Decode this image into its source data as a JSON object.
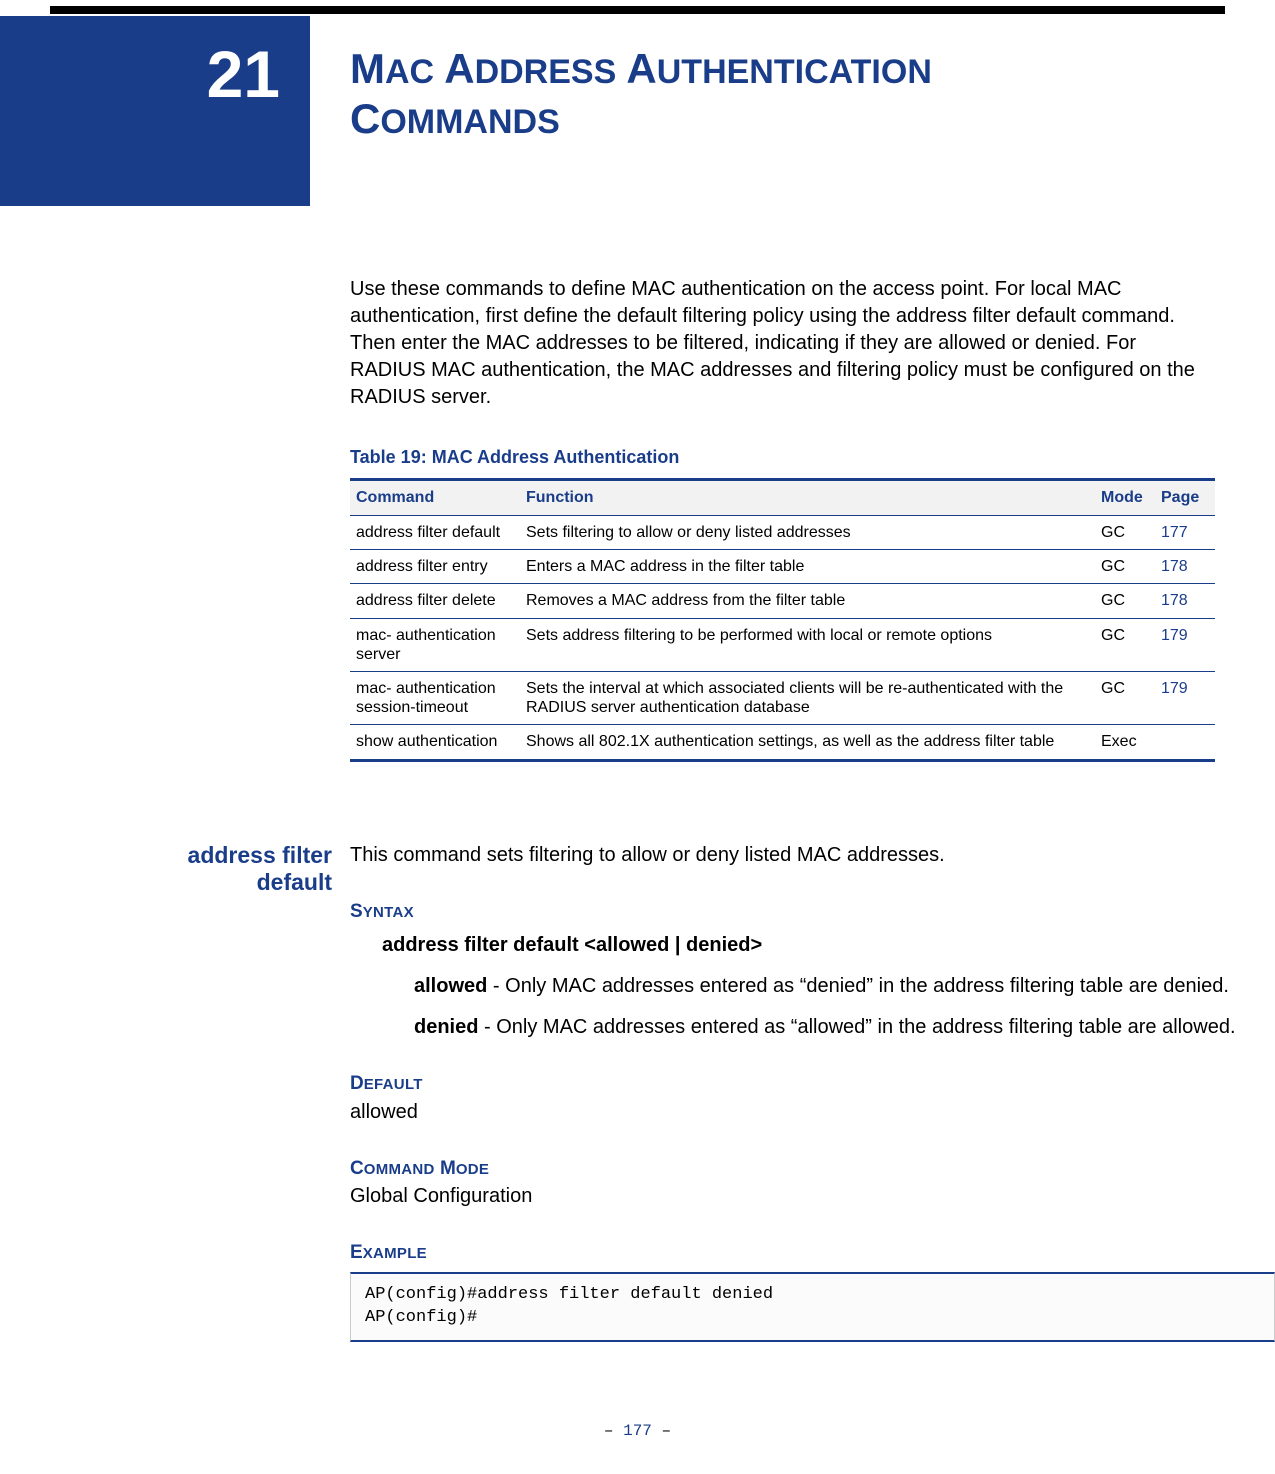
{
  "chapter": {
    "number": "21",
    "title_first_cap_1": "M",
    "title_sc_1": "AC",
    "title_space_1": " ",
    "title_first_cap_2": "A",
    "title_sc_2": "DDRESS",
    "title_space_2": " ",
    "title_first_cap_3": "A",
    "title_sc_3": "UTHENTICATION",
    "title_first_cap_4": "C",
    "title_sc_4": "OMMANDS"
  },
  "intro": "Use these commands to define MAC authentication on the access point. For local MAC authentication, first define the default filtering policy using the address filter default command. Then enter the MAC addresses to be filtered, indicating if they are allowed or denied. For RADIUS MAC authentication, the MAC addresses and filtering policy must be configured on the RADIUS server.",
  "table": {
    "title": "Table 19: MAC Address Authentication",
    "headers": {
      "c1": "Command",
      "c2": "Function",
      "c3": "Mode",
      "c4": "Page"
    },
    "rows": [
      {
        "cmd": "address filter default",
        "func": "Sets filtering to allow or deny listed addresses",
        "mode": "GC",
        "page": "177"
      },
      {
        "cmd": "address filter entry",
        "func": "Enters a MAC address in the filter table",
        "mode": "GC",
        "page": "178"
      },
      {
        "cmd": "address filter delete",
        "func": "Removes a MAC address from the filter table",
        "mode": "GC",
        "page": "178"
      },
      {
        "cmd": "mac- authentication server",
        "func": "Sets address filtering to be performed with local or remote options",
        "mode": "GC",
        "page": "179"
      },
      {
        "cmd": "mac- authentication session-timeout",
        "func": "Sets the interval at which associated clients will be re-authenticated with the RADIUS server authentication database",
        "mode": "GC",
        "page": "179"
      },
      {
        "cmd": "show authentication",
        "func": "Shows all 802.1X authentication settings, as well as the address filter table",
        "mode": "Exec",
        "page": ""
      }
    ]
  },
  "section": {
    "side_line1": "address filter",
    "side_line2": "default",
    "desc": "This command sets filtering to allow or deny listed MAC addresses.",
    "syntax": {
      "heading_cap": "S",
      "heading_sc": "YNTAX",
      "line": "address filter default <allowed | denied>",
      "params": [
        {
          "name": "allowed",
          "text": " - Only MAC addresses entered as “denied” in the address filtering table are denied."
        },
        {
          "name": "denied",
          "text": " - Only MAC addresses entered as “allowed” in the address filtering table are allowed."
        }
      ]
    },
    "default": {
      "heading_cap": "D",
      "heading_sc": "EFAULT",
      "value": "allowed"
    },
    "cmdmode": {
      "heading_cap_1": "C",
      "heading_sc_1": "OMMAND",
      "heading_space": " ",
      "heading_cap_2": "M",
      "heading_sc_2": "ODE",
      "value": "Global Configuration"
    },
    "example": {
      "heading_cap": "E",
      "heading_sc": "XAMPLE",
      "code": "AP(config)#address filter default denied\nAP(config)#"
    }
  },
  "footer": {
    "dash1": "–  ",
    "page": "177",
    "dash2": "  –"
  }
}
